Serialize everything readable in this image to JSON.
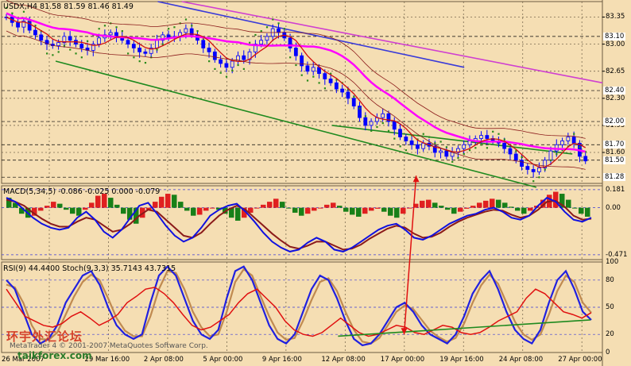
{
  "chart_data": [
    {
      "type": "candlestick",
      "panel": "price",
      "title": "USDX,H4  81.58 81.59 81.46 81.49",
      "ylim": [
        81.2,
        83.55
      ],
      "yticks": [
        "83.35",
        "83.00",
        "82.65",
        "82.30",
        "81.95",
        "81.60"
      ],
      "price_tags": [
        {
          "value": 83.1,
          "label": "83.10",
          "bg": "#ffffff",
          "color": "#000000"
        },
        {
          "value": 82.4,
          "label": "82.40",
          "bg": "#ffffff",
          "color": "#000000"
        },
        {
          "value": 82.0,
          "label": "82.00",
          "bg": "#ffffff",
          "color": "#000000"
        },
        {
          "value": 81.7,
          "label": "81.70",
          "bg": "#ffffff",
          "color": "#000000"
        },
        {
          "value": 81.5,
          "label": "81.50",
          "bg": "#ffffff",
          "color": "#000000"
        },
        {
          "value": 81.28,
          "label": "81.28",
          "bg": "#ffffff",
          "color": "#000000"
        }
      ],
      "close_path": [
        83.35,
        83.28,
        83.22,
        83.3,
        83.18,
        83.12,
        83.05,
        83.0,
        82.98,
        83.02,
        83.1,
        83.05,
        83.0,
        82.95,
        82.92,
        83.0,
        83.08,
        83.12,
        83.15,
        83.1,
        83.05,
        83.0,
        82.95,
        82.9,
        82.88,
        82.95,
        83.05,
        83.12,
        83.08,
        83.1,
        83.15,
        83.2,
        83.12,
        83.05,
        82.95,
        82.9,
        82.8,
        82.75,
        82.7,
        82.78,
        82.85,
        82.8,
        82.9,
        83.0,
        83.05,
        83.1,
        83.2,
        83.15,
        83.08,
        82.95,
        82.85,
        82.72,
        82.65,
        82.7,
        82.62,
        82.55,
        82.5,
        82.42,
        82.38,
        82.3,
        82.2,
        82.05,
        81.95,
        82.0,
        82.05,
        82.1,
        82.0,
        81.9,
        81.8,
        81.75,
        81.7,
        81.65,
        81.72,
        81.68,
        81.6,
        81.62,
        81.55,
        81.6,
        81.65,
        81.7,
        81.75,
        81.78,
        81.82,
        81.78,
        81.75,
        81.72,
        81.65,
        81.58,
        81.5,
        81.42,
        81.38,
        81.35,
        81.4,
        81.5,
        81.62,
        81.7,
        81.75,
        81.8,
        81.72,
        81.55,
        81.49
      ],
      "indicators": [
        {
          "name": "MA fast",
          "color": "#d01010"
        },
        {
          "name": "MA slow",
          "color": "#ff00ff"
        },
        {
          "name": "Parabolic SAR",
          "color": "#2a8a1a"
        },
        {
          "name": "Channel lines",
          "color": "#8b1a1a"
        }
      ],
      "trendlines": [
        {
          "from": [
            0.09,
            82.78
          ],
          "to": [
            0.89,
            81.15
          ],
          "color": "#1f8a1f"
        },
        {
          "from": [
            0.55,
            81.95
          ],
          "to": [
            0.95,
            81.58
          ],
          "color": "#1f8a1f"
        },
        {
          "from": [
            0.26,
            83.55
          ],
          "to": [
            0.77,
            82.7
          ],
          "color": "#3a3ad8"
        },
        {
          "from": [
            0.3,
            83.55
          ],
          "to": [
            1.0,
            82.5
          ],
          "color": "#d040d0"
        }
      ]
    },
    {
      "type": "histogram+line",
      "panel": "macd",
      "title": "MACD(5,34,5)  -0.086  -0.025  0.000  -0.079",
      "ylim": [
        -0.52,
        0.22
      ],
      "yticks": [
        "0.181",
        "0.00",
        "-0.471"
      ],
      "values": [
        0.1,
        0.05,
        -0.06,
        -0.1,
        -0.08,
        -0.03,
        0.02,
        0.06,
        0.04,
        -0.02,
        -0.06,
        -0.08,
        -0.02,
        0.05,
        0.12,
        0.14,
        0.1,
        0.03,
        -0.06,
        -0.12,
        -0.16,
        -0.1,
        -0.02,
        0.06,
        0.11,
        0.14,
        0.13,
        0.06,
        -0.03,
        -0.08,
        -0.07,
        -0.03,
        0.0,
        -0.02,
        -0.06,
        -0.1,
        -0.13,
        -0.1,
        -0.05,
        0.0,
        0.03,
        0.06,
        0.09,
        0.06,
        0.0,
        -0.05,
        -0.08,
        -0.06,
        -0.03,
        0.0,
        0.03,
        0.05,
        0.02,
        -0.04,
        -0.07,
        -0.09,
        -0.06,
        -0.03,
        -0.01,
        -0.04,
        -0.08,
        -0.1,
        -0.06,
        0.0,
        0.04,
        0.07,
        0.08,
        0.05,
        0.02,
        -0.02,
        -0.06,
        -0.04,
        -0.01,
        0.02,
        0.05,
        0.07,
        0.09,
        0.08,
        0.05,
        0.01,
        -0.03,
        -0.06,
        -0.03,
        0.02,
        0.08,
        0.13,
        0.16,
        0.14,
        0.08,
        0.0,
        -0.06,
        -0.09
      ],
      "line_main": [
        0.1,
        0.06,
        -0.02,
        -0.1,
        -0.16,
        -0.2,
        -0.22,
        -0.2,
        -0.1,
        -0.04,
        -0.12,
        -0.24,
        -0.3,
        -0.22,
        -0.1,
        0.02,
        0.05,
        -0.06,
        -0.18,
        -0.28,
        -0.34,
        -0.3,
        -0.2,
        -0.08,
        -0.02,
        0.02,
        0.04,
        -0.04,
        -0.14,
        -0.25,
        -0.34,
        -0.4,
        -0.44,
        -0.42,
        -0.35,
        -0.3,
        -0.34,
        -0.42,
        -0.44,
        -0.4,
        -0.34,
        -0.28,
        -0.22,
        -0.18,
        -0.16,
        -0.22,
        -0.3,
        -0.32,
        -0.28,
        -0.22,
        -0.16,
        -0.12,
        -0.08,
        -0.06,
        -0.02,
        0.0,
        -0.04,
        -0.1,
        -0.12,
        -0.08,
        0.02,
        0.1,
        0.06,
        -0.04,
        -0.12,
        -0.14,
        -0.1
      ],
      "line_signal": [
        0.08,
        0.06,
        0.02,
        -0.05,
        -0.11,
        -0.16,
        -0.19,
        -0.19,
        -0.14,
        -0.1,
        -0.12,
        -0.18,
        -0.24,
        -0.22,
        -0.16,
        -0.08,
        -0.02,
        -0.04,
        -0.12,
        -0.2,
        -0.28,
        -0.3,
        -0.25,
        -0.16,
        -0.08,
        -0.02,
        0.02,
        -0.02,
        -0.1,
        -0.18,
        -0.26,
        -0.33,
        -0.39,
        -0.41,
        -0.38,
        -0.34,
        -0.34,
        -0.38,
        -0.42,
        -0.41,
        -0.37,
        -0.31,
        -0.26,
        -0.21,
        -0.18,
        -0.2,
        -0.26,
        -0.3,
        -0.29,
        -0.25,
        -0.19,
        -0.14,
        -0.1,
        -0.07,
        -0.04,
        -0.02,
        -0.03,
        -0.07,
        -0.1,
        -0.08,
        -0.02,
        0.06,
        0.07,
        0.01,
        -0.08,
        -0.12,
        -0.11
      ],
      "hist_colors": {
        "up": "#e02020",
        "down": "#188018"
      },
      "line_colors": {
        "main": "#1010e0",
        "signal": "#8b1a1a"
      }
    },
    {
      "type": "line",
      "panel": "rsi-stoch",
      "title": "RSI(9) 44.4400  Stoch(9,3,3) 35.7143 43.7315",
      "ylim": [
        0,
        100
      ],
      "yticks": [
        "100",
        "80",
        "50",
        "20",
        "0"
      ],
      "series": [
        {
          "name": "RSI(9)",
          "color": "#e01010",
          "values": [
            70,
            55,
            40,
            35,
            30,
            28,
            32,
            40,
            45,
            38,
            30,
            35,
            42,
            55,
            62,
            70,
            72,
            65,
            55,
            42,
            30,
            25,
            28,
            35,
            42,
            55,
            65,
            70,
            60,
            50,
            35,
            25,
            20,
            18,
            22,
            30,
            38,
            30,
            22,
            18,
            20,
            25,
            30,
            28,
            22,
            20,
            25,
            30,
            28,
            22,
            20,
            22,
            28,
            35,
            40,
            45,
            60,
            70,
            65,
            55,
            45,
            42,
            38,
            44
          ]
        },
        {
          "name": "Stoch main",
          "color": "#2020e0",
          "values": [
            80,
            70,
            45,
            20,
            10,
            15,
            30,
            55,
            70,
            85,
            90,
            75,
            50,
            30,
            20,
            15,
            20,
            55,
            85,
            95,
            85,
            60,
            35,
            20,
            15,
            25,
            60,
            90,
            95,
            80,
            55,
            30,
            15,
            10,
            20,
            45,
            70,
            85,
            80,
            60,
            35,
            15,
            8,
            10,
            20,
            35,
            50,
            55,
            45,
            30,
            20,
            15,
            10,
            20,
            40,
            65,
            80,
            90,
            70,
            45,
            25,
            15,
            10,
            25,
            55,
            80,
            90,
            70,
            45,
            36
          ]
        },
        {
          "name": "Stoch signal",
          "color": "#c08a50",
          "values": [
            75,
            72,
            55,
            30,
            15,
            14,
            22,
            42,
            62,
            78,
            86,
            80,
            60,
            38,
            24,
            18,
            18,
            40,
            70,
            90,
            88,
            70,
            45,
            28,
            18,
            20,
            45,
            78,
            92,
            85,
            62,
            40,
            22,
            14,
            16,
            35,
            58,
            78,
            82,
            68,
            45,
            25,
            12,
            10,
            16,
            30,
            45,
            52,
            48,
            36,
            24,
            17,
            12,
            16,
            32,
            55,
            74,
            86,
            76,
            55,
            34,
            20,
            14,
            20,
            42,
            68,
            85,
            78,
            55,
            44
          ]
        }
      ],
      "levels": [
        20,
        50,
        80
      ],
      "trendline": {
        "from": [
          0.56,
          18
        ],
        "to": [
          0.98,
          36
        ],
        "color": "#1f8a1f"
      }
    }
  ],
  "x_axis": {
    "labels": [
      "26 Mar 2007",
      "29 Mar 16:00",
      "2 Apr 08:00",
      "5 Apr 00:00",
      "9 Apr 16:00",
      "12 Apr 08:00",
      "17 Apr 00:00",
      "19 Apr 16:00",
      "24 Apr 08:00",
      "27 Apr 00:00"
    ]
  },
  "arrows": [
    {
      "panel": "price",
      "from": [
        0.69,
        0.96
      ],
      "to": [
        0.67,
        1.25
      ],
      "color": "#e01010"
    }
  ],
  "watermark": {
    "copyright": "MetaTrader 4  © 2001-2007 MetaQuotes Software Corp.",
    "logo_cn": "环宇外汇论坛",
    "logo_site": "taikforex.com"
  },
  "colors": {
    "background": "#f5deb3",
    "bull_candle": "#0000ff",
    "bear_candle": "#0000ff",
    "grid": "#8b7d6b"
  }
}
